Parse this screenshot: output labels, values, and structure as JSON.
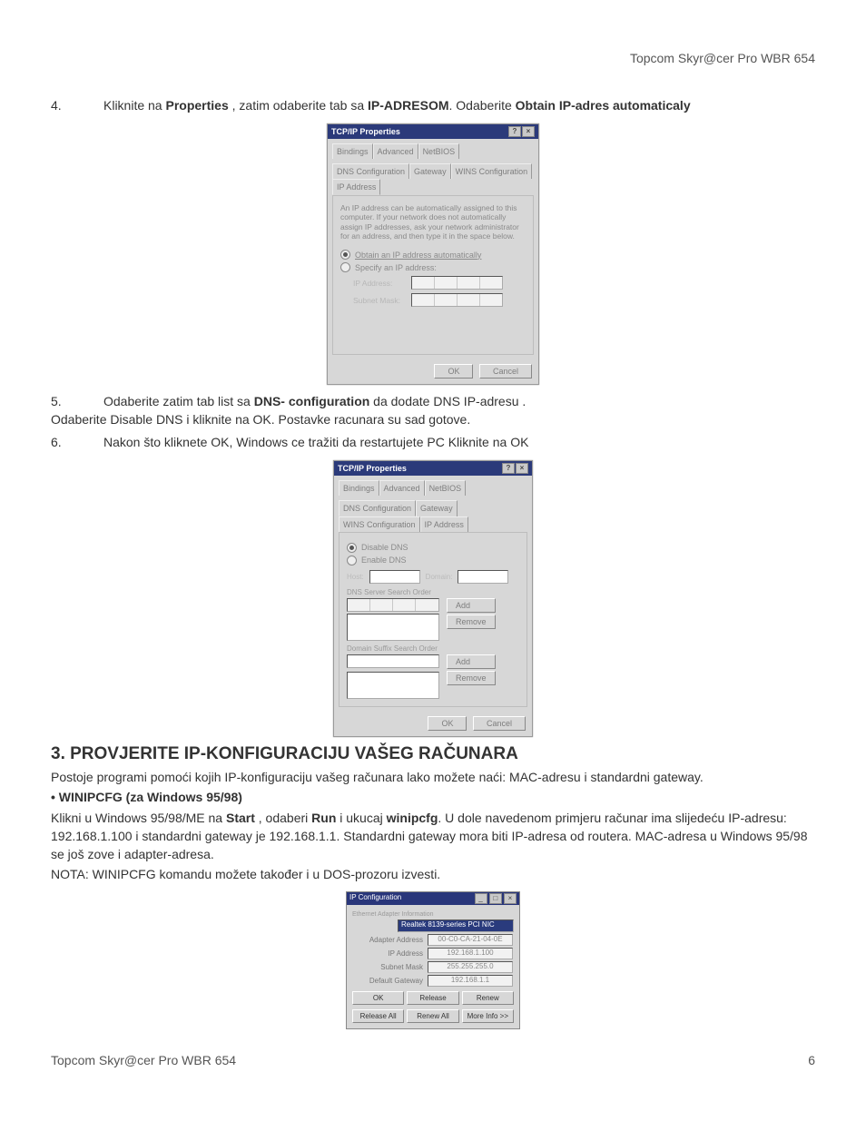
{
  "header": {
    "product": "Topcom Skyr@cer Pro WBR 654"
  },
  "footer": {
    "product": "Topcom Skyr@cer Pro WBR 654",
    "page": "6"
  },
  "steps": {
    "s4": {
      "num": "4.",
      "pre": "Kliknite na ",
      "b1": "Properties",
      "mid": "  , zatim odaberite tab sa ",
      "b2": "IP-ADRESOM",
      "post": ". Odaberite ",
      "b3": "Obtain  IP-adres automaticaly"
    },
    "s5": {
      "num": "5.",
      "pre": "Odaberite zatim tab list sa ",
      "b1": "DNS- configuration",
      "post": " da dodate DNS IP-adresu .",
      "cont": "Odaberite  Disable DNS i  kliknite na OK. Postavke racunara  su sad gotove."
    },
    "s6": {
      "num": "6.",
      "text": "Nakon što kliknete OK, Windows ce tražiti da restartujete PC Kliknite na OK"
    }
  },
  "dialog1": {
    "title": "TCP/IP Properties",
    "tabs": [
      "Bindings",
      "Advanced",
      "NetBIOS",
      "DNS Configuration",
      "Gateway",
      "WINS Configuration",
      "IP Address"
    ],
    "active_tab": "IP Address",
    "desc": "An IP address can be automatically assigned to this computer. If your network does not automatically assign IP addresses, ask your network administrator for an address, and then type it in the space below.",
    "radio_obtain": "Obtain an IP address automatically",
    "radio_specify": "Specify an IP address:",
    "lbl_ip": "IP Address:",
    "lbl_mask": "Subnet Mask:",
    "ok": "OK",
    "cancel": "Cancel"
  },
  "dialog2": {
    "title": "TCP/IP Properties",
    "tabs": [
      "Bindings",
      "Advanced",
      "NetBIOS",
      "DNS Configuration",
      "Gateway",
      "WINS Configuration",
      "IP Address"
    ],
    "active_tab": "DNS Configuration",
    "radio_disable": "Disable DNS",
    "radio_enable": "Enable DNS",
    "lbl_host": "Host:",
    "lbl_domain": "Domain:",
    "lbl_dns_order": "DNS Server Search Order",
    "btn_add1": "Add",
    "btn_remove1": "Remove",
    "lbl_suffix": "Domain Suffix Search Order",
    "btn_add2": "Add",
    "btn_remove2": "Remove",
    "ok": "OK",
    "cancel": "Cancel"
  },
  "section3": {
    "title": "3.    PROVJERITE IP-KONFIGURACIJU VAŠEG RAČUNARA",
    "p1": "Postoje programi pomoći kojih IP-konfiguraciju vašeg računara lako možete naći: MAC-adresu i standardni  gateway.",
    "bullet": "• WINIPCFG (za Windows 95/98)",
    "p2a": "Klikni u Windows 95/98/ME  na  ",
    "p2_b1": "Start",
    "p2b": " , odaberi ",
    "p2_b2": "Run",
    "p2c": " i ukucaj ",
    "p2_b3": "winipcfg",
    "p2d": ". U dole navedenom primjeru računar ima slijedeću IP-adresu: 192.168.1.100 i  standardni gateway je 192.168.1.1. Standardni gateway mora biti IP-adresa od routera. MAC-adresa u Windows 95/98 se još zove i adapter-adresa.",
    "note": "NOTA: WINIPCFG komandu možete također i u DOS-prozoru izvesti."
  },
  "ipcfg": {
    "title": "IP Configuration",
    "group": "Ethernet Adapter Information",
    "adapter": "Realtek 8139-series PCI NIC",
    "rows": {
      "adapter_addr_k": "Adapter Address",
      "adapter_addr_v": "00-C0-CA-21-04-0E",
      "ip_k": "IP Address",
      "ip_v": "192.168.1.100",
      "mask_k": "Subnet Mask",
      "mask_v": "255.255.255.0",
      "gw_k": "Default Gateway",
      "gw_v": "192.168.1.1"
    },
    "btns": [
      "OK",
      "Release",
      "Renew",
      "Release All",
      "Renew All",
      "More Info >>"
    ]
  }
}
